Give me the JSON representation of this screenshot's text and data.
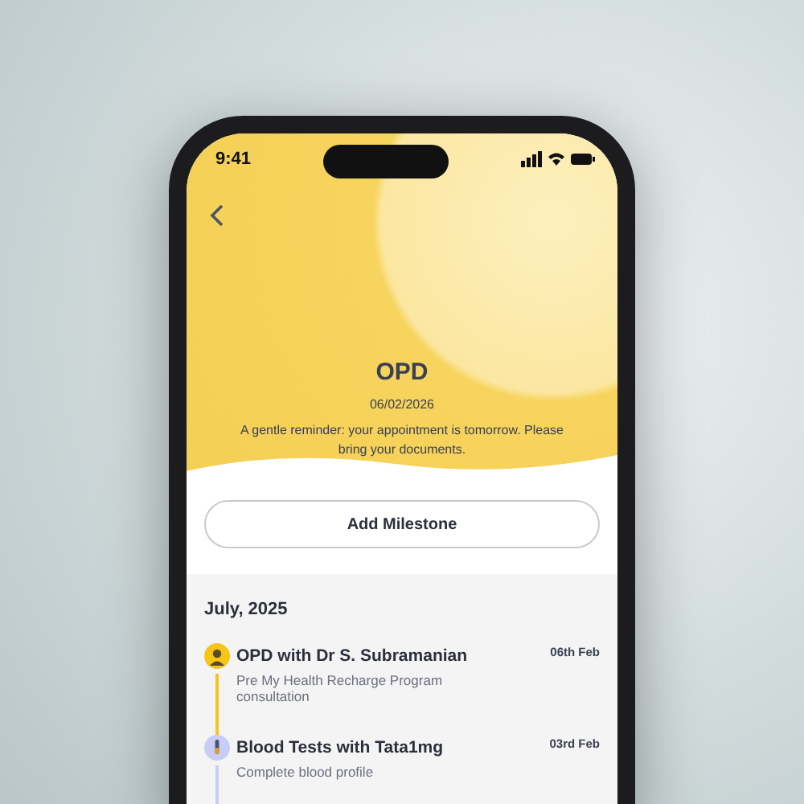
{
  "status_bar": {
    "time": "9:41"
  },
  "header": {
    "title": "OPD",
    "date": "06/02/2026",
    "message": "A gentle reminder: your appointment is tomorrow. Please bring your documents."
  },
  "add_button": {
    "label": "Add Milestone"
  },
  "timeline": {
    "month": "July, 2025",
    "items": [
      {
        "kind": "consultation",
        "color": "#f5c518",
        "title": "OPD with Dr S. Subramanian",
        "subtitle": "Pre My Health Recharge Program consultation",
        "date": "06th Feb"
      },
      {
        "kind": "test",
        "color": "#c7cdf5",
        "title": "Blood Tests with Tata1mg",
        "subtitle": "Complete blood profile",
        "date": "03rd Feb"
      }
    ]
  }
}
